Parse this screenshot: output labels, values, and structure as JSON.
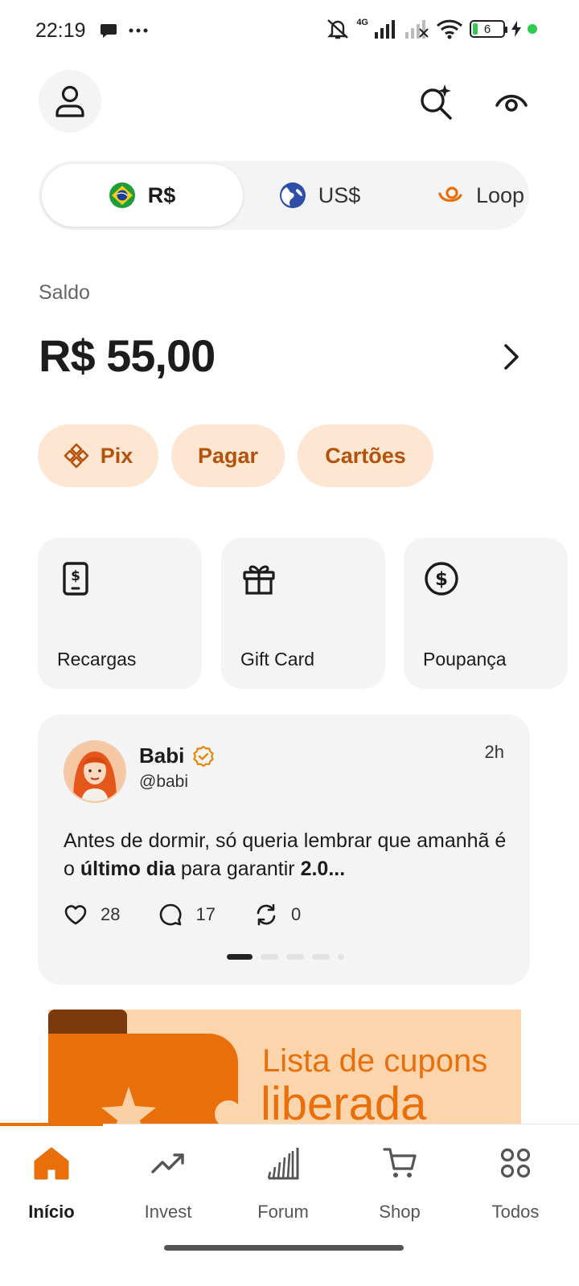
{
  "status_bar": {
    "time": "22:19",
    "network": "4G",
    "battery_level": "6"
  },
  "header": {
    "icons": [
      "user-icon",
      "search-sparkle-icon",
      "eye-icon"
    ]
  },
  "currency_tabs": [
    {
      "label": "R$",
      "icon": "brazil-flag-icon",
      "active": true
    },
    {
      "label": "US$",
      "icon": "globe-icon",
      "active": false
    },
    {
      "label": "Loop",
      "icon": "loop-icon",
      "active": false
    }
  ],
  "balance": {
    "label": "Saldo",
    "value": "R$ 55,00"
  },
  "actions": [
    {
      "label": "Pix",
      "icon": "pix-icon"
    },
    {
      "label": "Pagar"
    },
    {
      "label": "Cartões"
    }
  ],
  "quick_cards": [
    {
      "label": "Recargas",
      "icon": "phone-recharge-icon"
    },
    {
      "label": "Gift Card",
      "icon": "gift-icon"
    },
    {
      "label": "Poupança",
      "icon": "dollar-circle-icon"
    }
  ],
  "post": {
    "name": "Babi",
    "handle": "@babi",
    "time": "2h",
    "text_part1": "Antes de dormir, só queria lembrar que amanhã é o ",
    "text_bold1": "último dia",
    "text_part2": " para garantir ",
    "text_bold2": "2.0...",
    "likes": "28",
    "comments": "17",
    "reposts": "0",
    "carousel_active_index": 0,
    "carousel_count": 5
  },
  "banner": {
    "title": "Lista de cupons",
    "subtitle": "liberada"
  },
  "bottom_nav": [
    {
      "label": "Início",
      "icon": "home-icon",
      "active": true
    },
    {
      "label": "Invest",
      "icon": "trend-up-icon",
      "active": false
    },
    {
      "label": "Forum",
      "icon": "forum-icon",
      "active": false
    },
    {
      "label": "Shop",
      "icon": "cart-icon",
      "active": false
    },
    {
      "label": "Todos",
      "icon": "grid-dots-icon",
      "active": false
    }
  ],
  "colors": {
    "accent": "#e96f0a",
    "pill_bg": "#fde6d2",
    "pill_text": "#b4520c",
    "card_bg": "#f4f4f4"
  }
}
